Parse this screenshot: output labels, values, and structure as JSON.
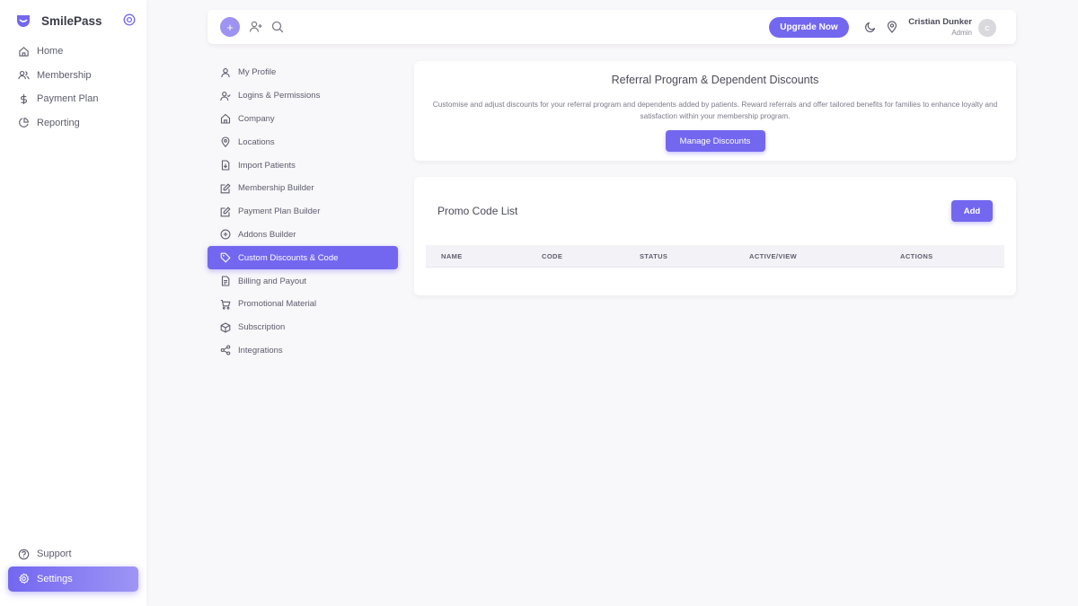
{
  "app": {
    "brand": "SmilePass",
    "accent_color": "#7367f0"
  },
  "sidebar": {
    "items": [
      {
        "label": "Home",
        "icon": "home-icon"
      },
      {
        "label": "Membership",
        "icon": "users-icon"
      },
      {
        "label": "Payment Plan",
        "icon": "dollar-icon"
      },
      {
        "label": "Reporting",
        "icon": "pie-chart-icon"
      }
    ],
    "bottom_items": [
      {
        "label": "Support",
        "icon": "help-circle-icon"
      },
      {
        "label": "Settings",
        "icon": "gear-icon",
        "active": true
      }
    ]
  },
  "topbar": {
    "upgrade_label": "Upgrade Now",
    "user_name": "Cristian Dunker",
    "user_role": "Admin",
    "avatar_initial": "C"
  },
  "settings_nav": {
    "items": [
      {
        "label": "My Profile",
        "icon": "user-icon"
      },
      {
        "label": "Logins & Permissions",
        "icon": "user-check-icon"
      },
      {
        "label": "Company",
        "icon": "building-icon"
      },
      {
        "label": "Locations",
        "icon": "map-pin-icon"
      },
      {
        "label": "Import Patients",
        "icon": "file-import-icon"
      },
      {
        "label": "Membership Builder",
        "icon": "edit-icon"
      },
      {
        "label": "Payment Plan Builder",
        "icon": "edit-icon"
      },
      {
        "label": "Addons Builder",
        "icon": "plus-circle-icon"
      },
      {
        "label": "Custom Discounts & Code",
        "icon": "tag-icon",
        "active": true
      },
      {
        "label": "Billing and Payout",
        "icon": "file-text-icon"
      },
      {
        "label": "Promotional Material",
        "icon": "shopping-cart-icon"
      },
      {
        "label": "Subscription",
        "icon": "package-icon"
      },
      {
        "label": "Integrations",
        "icon": "share-icon"
      }
    ]
  },
  "referral": {
    "title": "Referral Program & Dependent Discounts",
    "description": "Customise and adjust discounts for your referral program and dependents added by patients. Reward referrals and offer tailored benefits for families to enhance loyalty and satisfaction within your membership program.",
    "button_label": "Manage Discounts"
  },
  "promo": {
    "title": "Promo Code List",
    "add_label": "Add",
    "columns": [
      "NAME",
      "CODE",
      "STATUS",
      "ACTIVE/VIEW",
      "ACTIONS"
    ],
    "rows": []
  }
}
